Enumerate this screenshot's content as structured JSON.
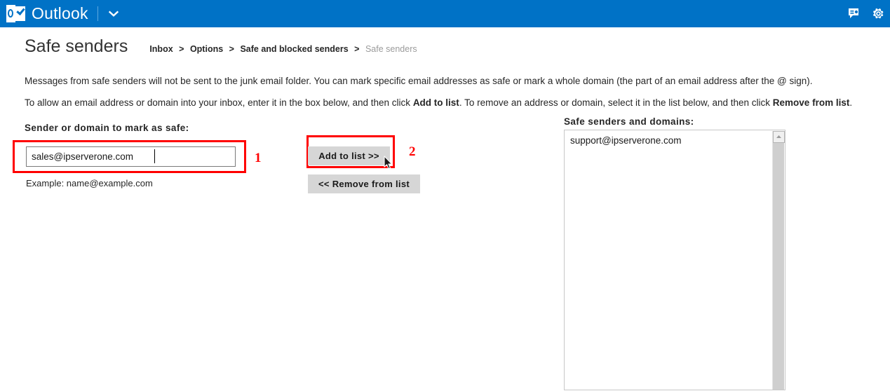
{
  "appbar": {
    "brand_name": "Outlook",
    "logo_icon": "outlook-logo-icon",
    "chevron_icon": "chevron-down-icon",
    "skype_icon": "skype-chat-icon",
    "settings_icon": "gear-icon",
    "background_color": "#0072c6"
  },
  "header": {
    "page_title": "Safe senders",
    "breadcrumb": [
      {
        "label": "Inbox",
        "current": false
      },
      {
        "label": "Options",
        "current": false
      },
      {
        "label": "Safe and blocked senders",
        "current": false
      },
      {
        "label": "Safe senders",
        "current": true
      }
    ],
    "breadcrumb_separator": ">"
  },
  "main": {
    "paragraph_1_part_1": "Messages from safe senders will not be sent to the junk email folder. You can mark specific email addresses as safe or mark a whole domain (the part of an email address after the @ sign).",
    "paragraph_2_part_1": "To allow an email address or domain into your inbox, enter it in the box below, and then click ",
    "paragraph_2_bold_1": "Add to list",
    "paragraph_2_part_2": ". To remove an address or domain, select it in the list below, and then click ",
    "paragraph_2_bold_2": "Remove from list",
    "paragraph_2_part_3": ".",
    "sender_field_label": "Sender or domain to mark as safe:",
    "sender_input_value": "sales@ipserverone.com",
    "sender_input_placeholder": "name@example.com",
    "example_text": "Example: name@example.com",
    "add_button_label": "Add to list >>",
    "remove_button_label": "<< Remove from list",
    "list_label": "Safe senders and domains:",
    "list_items": [
      "support@ipserverone.com"
    ]
  },
  "annotations": {
    "color": "#ff0000",
    "marker_1": "1",
    "marker_2": "2"
  }
}
